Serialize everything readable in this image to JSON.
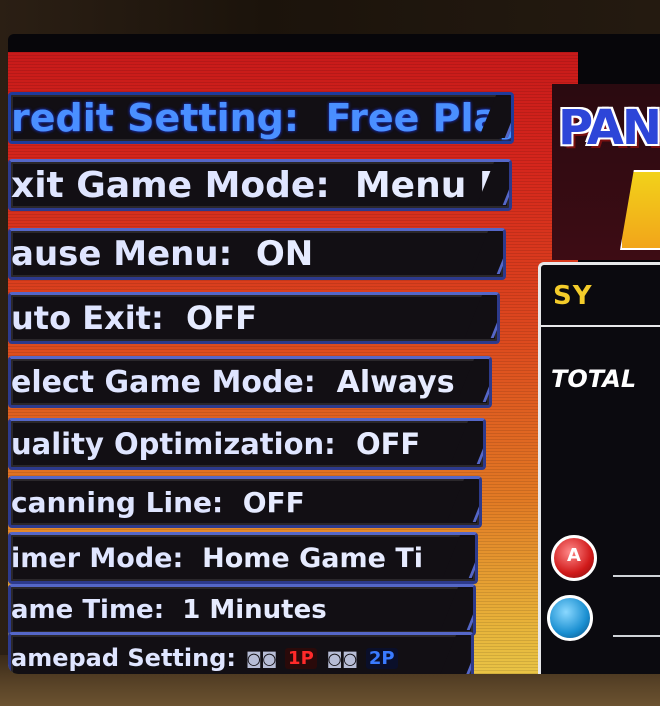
{
  "menu": {
    "items": [
      {
        "label": "redit Setting:",
        "value": "Free Play"
      },
      {
        "label": "xit Game Mode:",
        "value": "Menu Exit"
      },
      {
        "label": "ause Menu:",
        "value": "ON"
      },
      {
        "label": "uto Exit:",
        "value": "OFF"
      },
      {
        "label": "elect Game Mode:",
        "value": "Always"
      },
      {
        "label": "uality Optimization:",
        "value": "OFF"
      },
      {
        "label": "canning Line:",
        "value": "OFF"
      },
      {
        "label": "imer Mode:",
        "value": "Home Game Ti"
      },
      {
        "label": "ame Time:",
        "value": "1 Minutes"
      },
      {
        "label": "amepad Setting:",
        "value": ""
      }
    ],
    "gamepad_tokens": {
      "p1": "1P",
      "p2": "2P",
      "pad1": "◙◙",
      "pad2": "◙◙"
    }
  },
  "logo": {
    "text": "PAN"
  },
  "system": {
    "title": "SY",
    "total_label": "TOTAL",
    "button_a": "A",
    "button_b": ""
  },
  "colors": {
    "selected_text": "#4a8fff",
    "menu_red": "#c81a1a",
    "system_title": "#f4cc2a"
  }
}
